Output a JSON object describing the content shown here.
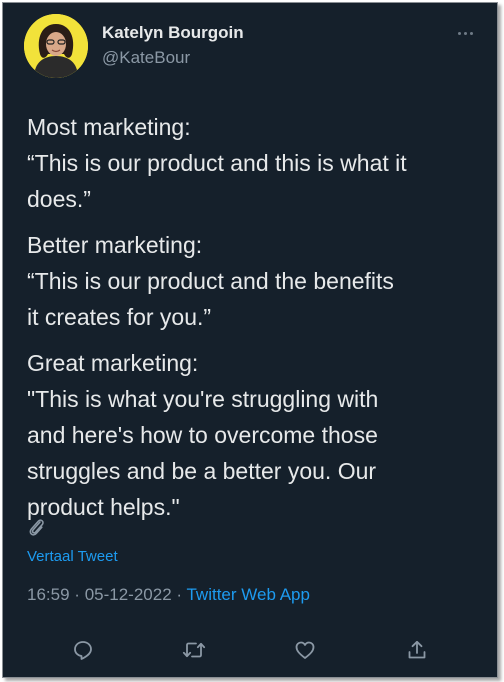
{
  "author": {
    "name": "Katelyn Bourgoin",
    "handle": "@KateBour"
  },
  "tweet": {
    "paragraphs": [
      [
        "Most marketing:",
        "“This is our product and this is what it",
        "does.”"
      ],
      [
        "Better marketing:",
        "“This is our product and the benefits",
        "it creates for you.”"
      ],
      [
        "Great marketing:",
        "\"This is what you're struggling with",
        "and here's how to overcome those",
        "struggles and be a better you. Our",
        "product helps.\""
      ]
    ],
    "translate_label": "Vertaal Tweet",
    "time": "16:59",
    "date": "05-12-2022",
    "separator": "·",
    "source": "Twitter Web App"
  },
  "icons": {
    "more": "more-horizontal-icon",
    "attachment": "paperclip-icon",
    "reply": "reply-icon",
    "retweet": "retweet-icon",
    "like": "heart-icon",
    "share": "share-icon"
  },
  "colors": {
    "background": "#15202b",
    "text": "#e7e9ea",
    "muted": "#8b98a5",
    "accent": "#1d9bf0",
    "avatar_bg": "#f2e23a"
  }
}
